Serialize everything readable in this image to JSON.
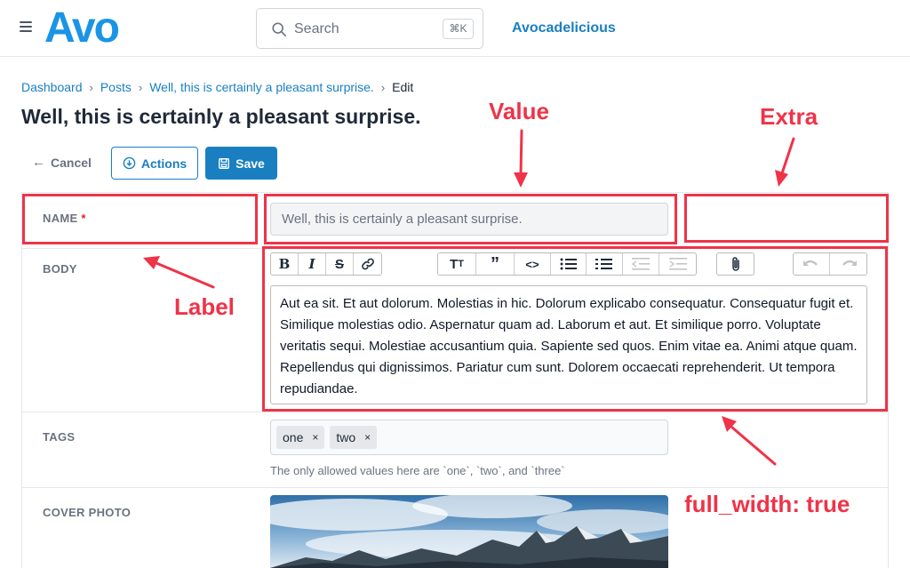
{
  "header": {
    "logo_text": "Avo",
    "search_placeholder": "Search",
    "search_shortcut": "⌘K",
    "brand_link": "Avocadelicious"
  },
  "breadcrumb": {
    "items": [
      "Dashboard",
      "Posts",
      "Well, this is certainly a pleasant surprise."
    ],
    "current": "Edit"
  },
  "page": {
    "title": "Well, this is certainly a pleasant surprise."
  },
  "actions": {
    "cancel_label": "Cancel",
    "actions_label": "Actions",
    "save_label": "Save"
  },
  "form": {
    "name": {
      "label": "NAME",
      "required_mark": "*",
      "value": "Well, this is certainly a pleasant surprise."
    },
    "body": {
      "label": "BODY",
      "toolbar_icons": [
        "bold-icon",
        "italic-icon",
        "strikethrough-icon",
        "link-icon",
        "heading-icon",
        "quote-icon",
        "code-icon",
        "bullet-list-icon",
        "number-list-icon",
        "outdent-icon",
        "indent-icon",
        "attach-icon",
        "undo-icon",
        "redo-icon"
      ],
      "value": "Aut ea sit. Et aut dolorum. Molestias in hic. Dolorum explicabo consequatur. Consequatur fugit et. Similique molestias odio. Aspernatur quam ad. Laborum et aut. Et similique porro. Voluptate veritatis sequi. Molestiae accusantium quia. Sapiente sed quos. Enim vitae ea. Animi atque quam. Repellendus qui dignissimos. Pariatur cum sunt. Dolorem occaecati reprehenderit. Ut tempora repudiandae."
    },
    "tags": {
      "label": "TAGS",
      "values": [
        "one",
        "two"
      ],
      "remove_symbol": "×",
      "help": "The only allowed values here are `one`, `two`, and `three`"
    },
    "cover_photo": {
      "label": "COVER PHOTO"
    }
  },
  "annotations": {
    "value": "Value",
    "extra": "Extra",
    "label": "Label",
    "full_width": "full_width: true"
  },
  "colors": {
    "accent": "#1a7fc1",
    "annotation": "#ef3348",
    "logo": "#1a94e6"
  }
}
